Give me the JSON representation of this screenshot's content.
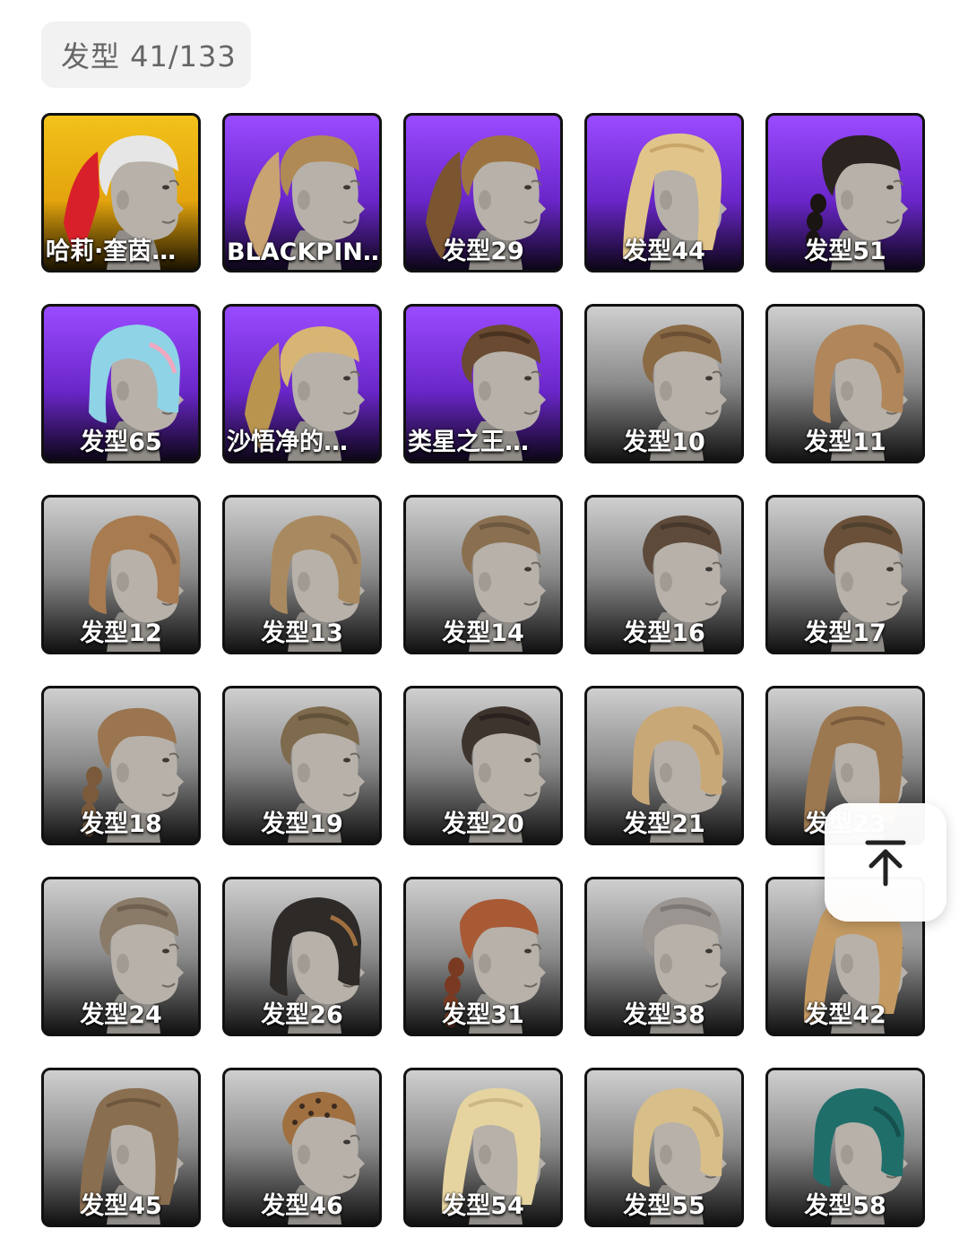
{
  "header": {
    "title": "发型 41/133"
  },
  "tiles": [
    {
      "label": "哈莉·奎茵…",
      "bg": "gold",
      "hair": "#e6e6e6",
      "accent": "#d8202a",
      "style": "pony"
    },
    {
      "label": "BLACKPIN…",
      "bg": "purple",
      "hair": "#b08a55",
      "accent": "#c9a371",
      "style": "pony"
    },
    {
      "label": "发型29",
      "bg": "purple",
      "hair": "#9c7340",
      "accent": "#7a5530",
      "style": "pony"
    },
    {
      "label": "发型44",
      "bg": "purple",
      "hair": "#e0c48a",
      "accent": "#c9a56a",
      "style": "long"
    },
    {
      "label": "发型51",
      "bg": "purple",
      "hair": "#2b2320",
      "accent": "#1a1412",
      "style": "braid"
    },
    {
      "label": "发型65",
      "bg": "purple",
      "hair": "#8fd3e6",
      "accent": "#f0a8c0",
      "style": "bob"
    },
    {
      "label": "沙悟净的…",
      "bg": "purple",
      "hair": "#d7b575",
      "accent": "#b8944f",
      "style": "pony"
    },
    {
      "label": "类星之王…",
      "bg": "purple",
      "hair": "#6a4a30",
      "accent": "#4a3220",
      "style": "short"
    },
    {
      "label": "发型10",
      "bg": "grey",
      "hair": "#8a6a45",
      "accent": "#6c5035",
      "style": "short"
    },
    {
      "label": "发型11",
      "bg": "grey",
      "hair": "#b0865a",
      "accent": "#8e6a44",
      "style": "bob"
    },
    {
      "label": "发型12",
      "bg": "grey",
      "hair": "#a87b50",
      "accent": "#8a6240",
      "style": "bob"
    },
    {
      "label": "发型13",
      "bg": "grey",
      "hair": "#a98a60",
      "accent": "#8c7050",
      "style": "bob"
    },
    {
      "label": "发型14",
      "bg": "grey",
      "hair": "#8a7050",
      "accent": "#6e5840",
      "style": "short"
    },
    {
      "label": "发型16",
      "bg": "grey",
      "hair": "#5e4a3a",
      "accent": "#46382c",
      "style": "short"
    },
    {
      "label": "发型17",
      "bg": "grey",
      "hair": "#6a5038",
      "accent": "#50402e",
      "style": "short"
    },
    {
      "label": "发型18",
      "bg": "grey",
      "hair": "#9a7550",
      "accent": "#7a5a3a",
      "style": "braid"
    },
    {
      "label": "发型19",
      "bg": "grey",
      "hair": "#7e6a4c",
      "accent": "#62523a",
      "style": "short"
    },
    {
      "label": "发型20",
      "bg": "grey",
      "hair": "#3e342e",
      "accent": "#2a221e",
      "style": "short"
    },
    {
      "label": "发型21",
      "bg": "grey",
      "hair": "#c9a878",
      "accent": "#a8865a",
      "style": "bob"
    },
    {
      "label": "发型23",
      "bg": "grey",
      "hair": "#9c7850",
      "accent": "#7a5c3c",
      "style": "long"
    },
    {
      "label": "发型24",
      "bg": "grey",
      "hair": "#8a7a68",
      "accent": "#6e604f",
      "style": "short"
    },
    {
      "label": "发型26",
      "bg": "grey",
      "hair": "#2e2a28",
      "accent": "#a07040",
      "style": "bob"
    },
    {
      "label": "发型31",
      "bg": "grey",
      "hair": "#a85a35",
      "accent": "#7a3a22",
      "style": "braid"
    },
    {
      "label": "发型38",
      "bg": "grey",
      "hair": "#9a9590",
      "accent": "#7c7874",
      "style": "short"
    },
    {
      "label": "发型42",
      "bg": "grey",
      "hair": "#c49a62",
      "accent": "#a47a46",
      "style": "long"
    },
    {
      "label": "发型45",
      "bg": "grey",
      "hair": "#8a6e50",
      "accent": "#6e563e",
      "style": "long"
    },
    {
      "label": "发型46",
      "bg": "grey",
      "hair": "#a07040",
      "accent": "#3a2a1e",
      "style": "buzz"
    },
    {
      "label": "发型54",
      "bg": "grey",
      "hair": "#e6d4a0",
      "accent": "#cbb783",
      "style": "long"
    },
    {
      "label": "发型55",
      "bg": "grey",
      "hair": "#d8be88",
      "accent": "#b89e6a",
      "style": "bob"
    },
    {
      "label": "发型58",
      "bg": "grey",
      "hair": "#1f6e6a",
      "accent": "#15504d",
      "style": "bob"
    }
  ],
  "back_to_top": {
    "icon": "arrow-up-to-top-icon"
  }
}
